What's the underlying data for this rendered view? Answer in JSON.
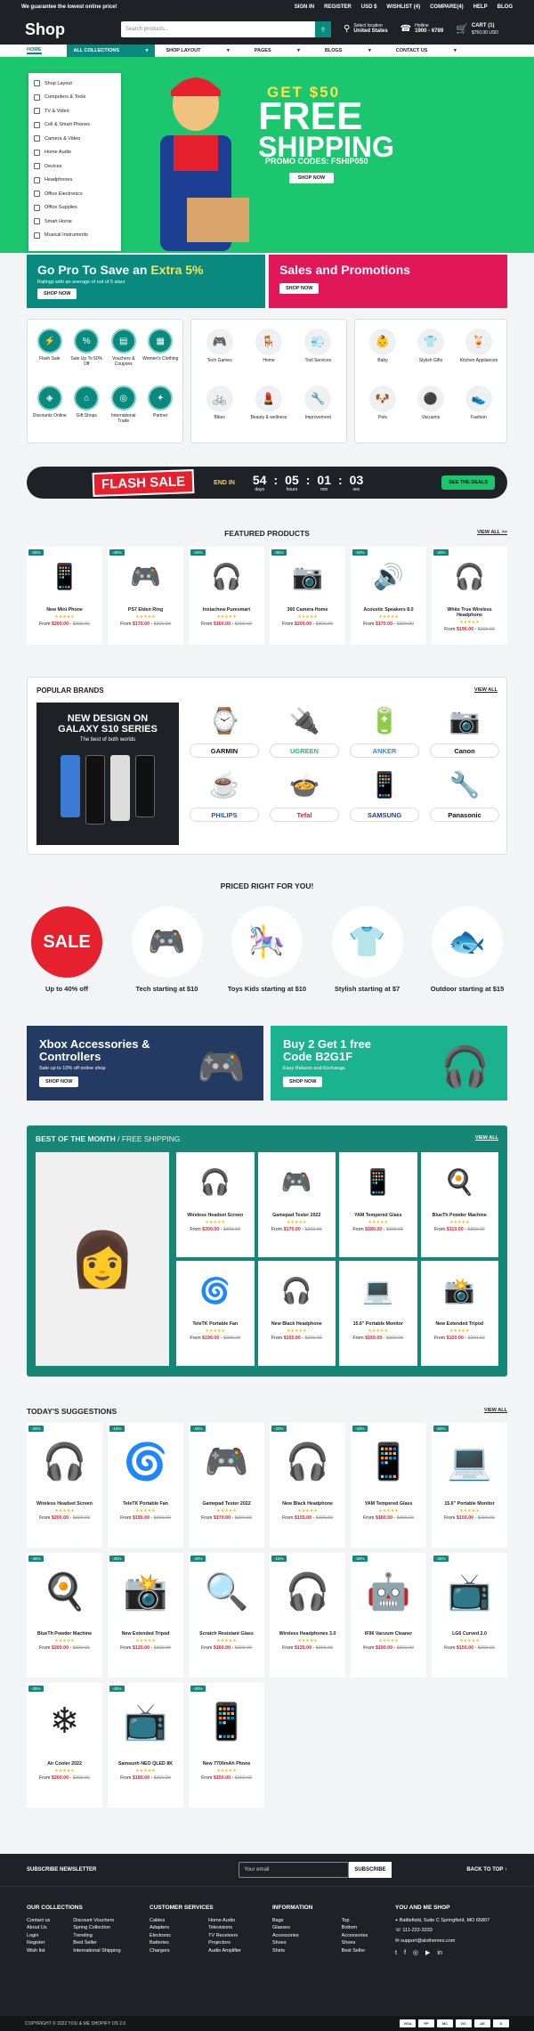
{
  "topbar": {
    "promo": "We guarantee the lowest online price!",
    "links": [
      "SIGN IN",
      "REGISTER",
      "USD $",
      "WISHLIST (4)",
      "COMPARE(4)",
      "HELP",
      "BLOG"
    ]
  },
  "header": {
    "logo": "Shop",
    "search_placeholder": "Search products...",
    "location_label": "Select location",
    "location": "United States",
    "hotline_label": "Hotline",
    "hotline": "1900 - 6789",
    "cart_label": "CART (1)",
    "cart_total": "$750.00 USD"
  },
  "nav": {
    "items": [
      "HOME",
      "ALL COLLECTIONS",
      "SHOP LAYOUT",
      "PAGES",
      "BLOGS",
      "CONTACT US"
    ]
  },
  "sidemenu": [
    "Shop Layout",
    "Computers & Tools",
    "TV & Video",
    "Cell & Smart Phones",
    "Camera & Video",
    "Home Audio",
    "Devices",
    "Headphones",
    "Office Electronics",
    "Office Supplies",
    "Smart Home",
    "Musical Instruments"
  ],
  "hero": {
    "line1": "GET $50",
    "line2a": "FREE",
    "line2b": "SHIPPING",
    "code": "PROMO CODES: FSHIP050",
    "button": "SHOP NOW"
  },
  "promos": [
    {
      "title_a": "Go Pro To Save an",
      "title_b": "Extra 5%",
      "text": "Ratings with an average of out of 5 stars",
      "button": "SHOP NOW",
      "bg": "#0a8a7e"
    },
    {
      "title_a": "Sales and Promotions",
      "title_b": "",
      "text": "",
      "button": "SHOP NOW",
      "bg": "#e0185a"
    }
  ],
  "categories": {
    "group1": [
      "Flash Sale",
      "Sale Up To 50% Off",
      "Vouchers & Coupons",
      "Women's Clothing",
      "Discounts Online",
      "Gift Shops",
      "International Trade",
      "Partner"
    ],
    "group2": [
      "Tech Games",
      "Home",
      "Tool Services",
      "Bikes",
      "Beauty & wellness",
      "Improvement"
    ],
    "group3": [
      "Baby",
      "Stylish Gifts",
      "Kitchen Appliances",
      "Pets",
      "Vacuums",
      "Fashion"
    ]
  },
  "flash": {
    "title": "FLASH SALE",
    "end": "END IN",
    "days": "54",
    "hours": "05",
    "mins": "01",
    "secs": "03",
    "l_days": "days",
    "l_hours": "hours",
    "l_mins": "min",
    "l_secs": "sec",
    "button": "SEE THE DEALS"
  },
  "featured": {
    "title": "FEATURED PRODUCTS",
    "view_all": "VIEW ALL >>",
    "items": [
      {
        "name": "New Mini Phone",
        "badge": "-20%",
        "price": "$200.00",
        "old": "$300.00",
        "icon": "📱"
      },
      {
        "name": "PS7 Elden Ring",
        "badge": "-40%",
        "price": "$170.00",
        "old": "$300.00",
        "icon": "🎮"
      },
      {
        "name": "Instachew Puresmart",
        "badge": "-42%",
        "price": "$160.00",
        "old": "$300.00",
        "icon": "🎧"
      },
      {
        "name": "360 Camera Home",
        "badge": "-35%",
        "price": "$200.00",
        "old": "$300.00",
        "icon": "📷"
      },
      {
        "name": "Acoustic Speakers 8.0",
        "badge": "-20%",
        "price": "$170.00",
        "old": "$300.00",
        "icon": "🔊"
      },
      {
        "name": "White True Wireless Headphone",
        "badge": "-40%",
        "price": "$190.00",
        "old": "$300.00",
        "icon": "🎧"
      }
    ]
  },
  "brands": {
    "title": "POPULAR BRANDS",
    "view_all": "VIEW ALL",
    "banner_title": "NEW DESIGN ON GALAXY S10 SERIES",
    "banner_sub": "The best of both worlds",
    "items": [
      {
        "name": "GARMIN",
        "icon": "⌚",
        "color": "#111"
      },
      {
        "name": "UGREEN",
        "icon": "🔌",
        "color": "#1bc66f"
      },
      {
        "name": "ANKER",
        "icon": "🔋",
        "color": "#2c8fd6"
      },
      {
        "name": "Canon",
        "icon": "📷",
        "color": "#111"
      },
      {
        "name": "PHILIPS",
        "icon": "☕",
        "color": "#1a56c5"
      },
      {
        "name": "Tefal",
        "icon": "🍲",
        "color": "#e6212d"
      },
      {
        "name": "SAMSUNG",
        "icon": "📱",
        "color": "#1a3d8f"
      },
      {
        "name": "Panasonic",
        "icon": "🔧",
        "color": "#111"
      }
    ]
  },
  "priced": {
    "title": "PRICED RIGHT FOR YOU!",
    "sale": "SALE",
    "items": [
      "Up to 40% off",
      "Tech starting at $10",
      "Toys Kids starting at $10",
      "Stylish starting at $7",
      "Outdoor starting at $15"
    ]
  },
  "banners": [
    {
      "title": "Xbox Accessories & Controllers",
      "text": "Sale up to 10% off online shop",
      "button": "SHOP NOW"
    },
    {
      "title": "Buy 2 Get 1 free Code B2G1F",
      "text": "Easy Returns and Exchange.",
      "button": "SHOP NOW"
    }
  ],
  "best": {
    "title": "BEST OF THE MONTH",
    "sub": "/ FREE SHIPPING",
    "view_all": "VIEW ALL",
    "items": [
      {
        "name": "Wireless Headset Screen",
        "price": "$200.00",
        "old": "$300.00",
        "icon": "🎧"
      },
      {
        "name": "Gamepad Tester 2022",
        "price": "$170.00",
        "old": "$300.00",
        "icon": "🎮"
      },
      {
        "name": "YAM Tempered Glass",
        "price": "$180.00",
        "old": "$300.00",
        "icon": "📱"
      },
      {
        "name": "BlueTh Powder Machine",
        "price": "$110.00",
        "old": "$300.00",
        "icon": "🍳"
      },
      {
        "name": "TeleTK Portable Fan",
        "price": "$190.00",
        "old": "$300.00",
        "icon": "🌀"
      },
      {
        "name": "New Black Headphone",
        "price": "$155.00",
        "old": "$300.00",
        "icon": "🎧"
      },
      {
        "name": "15.6\" Portable Monitor",
        "price": "$150.00",
        "old": "$300.00",
        "icon": "💻"
      },
      {
        "name": "New Extended Tripod",
        "price": "$120.00",
        "old": "$300.00",
        "icon": "📸"
      }
    ]
  },
  "suggestions": {
    "title": "TODAY'S SUGGESTIONS",
    "view_all": "VIEW ALL",
    "items": [
      {
        "name": "Wireless Headset Screen",
        "badge": "-30%",
        "price": "$200.00",
        "old": "$300.00",
        "icon": "🎧"
      },
      {
        "name": "TeleTK Portable Fan",
        "badge": "-15%",
        "price": "$190.00",
        "old": "$300.00",
        "icon": "🌀"
      },
      {
        "name": "Gamepad Tester 2022",
        "badge": "-45%",
        "price": "$170.00",
        "old": "$300.00",
        "icon": "🎮"
      },
      {
        "name": "New Black Headphone",
        "badge": "-20%",
        "price": "$155.00",
        "old": "$300.00",
        "icon": "🎧"
      },
      {
        "name": "YAM Tempered Glass",
        "badge": "-40%",
        "price": "$180.00",
        "old": "$300.00",
        "icon": "📱"
      },
      {
        "name": "15.6\" Portable Monitor",
        "badge": "-50%",
        "price": "$150.00",
        "old": "$300.00",
        "icon": "💻"
      },
      {
        "name": "BlueTh Powder Machine",
        "badge": "-45%",
        "price": "$200.00",
        "old": "$300.00",
        "icon": "🍳"
      },
      {
        "name": "New Extended Tripod",
        "badge": "-35%",
        "price": "$120.00",
        "old": "$300.00",
        "icon": "📸"
      },
      {
        "name": "Scratch Resistant Glass",
        "badge": "-40%",
        "price": "$160.00",
        "old": "$300.00",
        "icon": "🔍"
      },
      {
        "name": "Wireless Headphones 3.0",
        "badge": "-15%",
        "price": "$120.00",
        "old": "$300.00",
        "icon": "🎧"
      },
      {
        "name": "IF96 Vacuum Cleaner",
        "badge": "-35%",
        "price": "$190.00",
        "old": "$300.00",
        "icon": "🤖"
      },
      {
        "name": "LG6 Curved 2.0",
        "badge": "-25%",
        "price": "$150.00",
        "old": "$300.00",
        "icon": "📺"
      },
      {
        "name": "Air Cooler 2022",
        "badge": "-35%",
        "price": "$200.00",
        "old": "$300.00",
        "icon": "❄"
      },
      {
        "name": "Samsunh NEO QLED 8K",
        "badge": "-45%",
        "price": "$180.00",
        "old": "$300.00",
        "icon": "📺"
      },
      {
        "name": "New 7700mAh Phone",
        "badge": "-30%",
        "price": "$150.00",
        "old": "$300.00",
        "icon": "📱"
      }
    ]
  },
  "newsletter": {
    "label": "SUBSCRIBE NEWSLETTER",
    "placeholder": "Your email",
    "button": "SUBSCRIBE",
    "back": "BACK TO TOP"
  },
  "footer": {
    "col1": {
      "title": "OUR COLLECTIONS",
      "a": [
        "Contact us",
        "About Us",
        "Login",
        "Register",
        "Wish list"
      ],
      "b": [
        "Discount Vouchers",
        "Spring Collection",
        "Trending",
        "Best Seller",
        "International Shipping"
      ]
    },
    "col2": {
      "title": "CUSTOMER SERVICES",
      "a": [
        "Cables",
        "Adapters",
        "Electronic",
        "Batteries",
        "Chargers"
      ],
      "b": [
        "Home Audio",
        "Televisions",
        "TV Receivers",
        "Projectors",
        "Audio Amplifier"
      ]
    },
    "col3": {
      "title": "INFORMATION",
      "a": [
        "Bags",
        "Glasses",
        "Accessories",
        "Shoes",
        "Shirts"
      ],
      "b": [
        "Top",
        "Bottom",
        "Accessories",
        "Shoes",
        "Best Seller"
      ]
    },
    "col4": {
      "title": "YOU AND ME SHOP",
      "address": "Battlefield, Suite C Springfield, MO 65807",
      "phone": "111-222-3333",
      "email": "support@alothemes.com"
    },
    "copyright": "COPYRIGHT © 2022 YOU & ME SHOPIFY OS 2.0",
    "payments": [
      "VISA",
      "PP",
      "MC",
      "DC",
      "AE",
      "D"
    ]
  }
}
